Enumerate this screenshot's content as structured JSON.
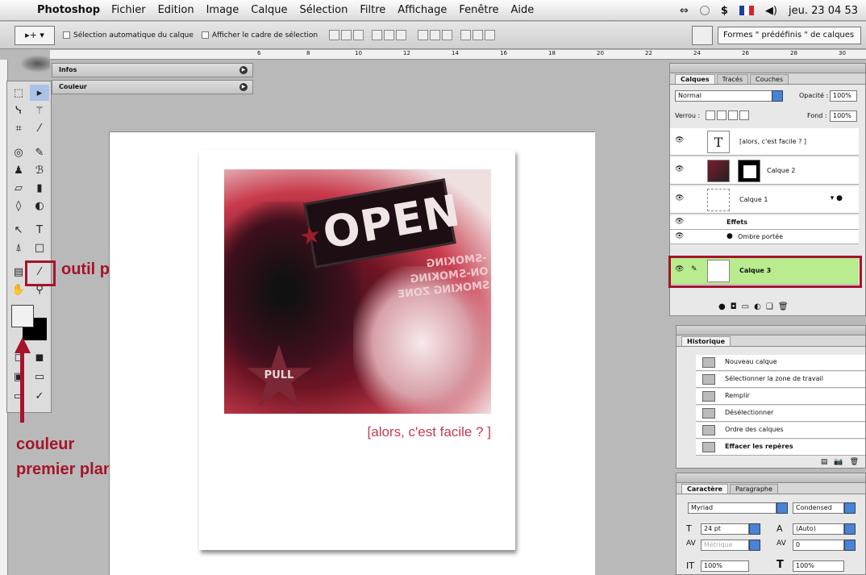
{
  "menubar": {
    "app": "Photoshop",
    "items": [
      "Fichier",
      "Edition",
      "Image",
      "Calque",
      "Sélection",
      "Filtre",
      "Affichage",
      "Fenêtre",
      "Aide"
    ],
    "clock": "jeu. 23 04 53"
  },
  "options": {
    "auto_select": "Sélection automatique du calque",
    "show_bbox": "Afficher le cadre de sélection",
    "presets": "Formes \" prédéfinis \" de calques"
  },
  "ruler_ticks": [
    "6",
    "8",
    "10",
    "12",
    "14",
    "16",
    "18",
    "20",
    "22",
    "24",
    "26",
    "28",
    "30"
  ],
  "panels": {
    "infos": "Infos",
    "couleur": "Couleur"
  },
  "annotations": {
    "pipette": "outil pipette",
    "color_line1": "couleur",
    "color_line2": "premier plan"
  },
  "document": {
    "sign_text": "OPEN",
    "smoking_lines": [
      "-SMOKING",
      "ON-SMOKING",
      "SMOKING ZONE"
    ],
    "pull_text": "PULL",
    "caption": "[alors, c'est facile ? ]"
  },
  "layers_panel": {
    "tabs": [
      "Calques",
      "Tracés",
      "Couches"
    ],
    "blend_mode": "Normal",
    "opacity_label": "Opacité :",
    "opacity": "100%",
    "lock_label": "Verrou :",
    "fill_label": "Fond :",
    "fill": "100%",
    "layers": [
      {
        "name": "[alors, c'est facile ? ]"
      },
      {
        "name": "Calque 2"
      },
      {
        "name": "Calque 1"
      },
      {
        "name": "Effets"
      },
      {
        "name": "Ombre portée"
      },
      {
        "name": "Calque 3"
      }
    ]
  },
  "history_panel": {
    "tab": "Historique",
    "items": [
      "Nouveau calque",
      "Sélectionner la zone de travail",
      "Remplir",
      "Désélectionner",
      "Ordre des calques",
      "Effacer les repères"
    ]
  },
  "character_panel": {
    "tabs": [
      "Caractère",
      "Paragraphe"
    ],
    "font": "Myriad",
    "style": "Condensed",
    "size": "24 pt",
    "leading": "(Auto)",
    "kerning": "Métrique",
    "tracking": "0",
    "vscale": "100%",
    "hscale": "100%"
  }
}
